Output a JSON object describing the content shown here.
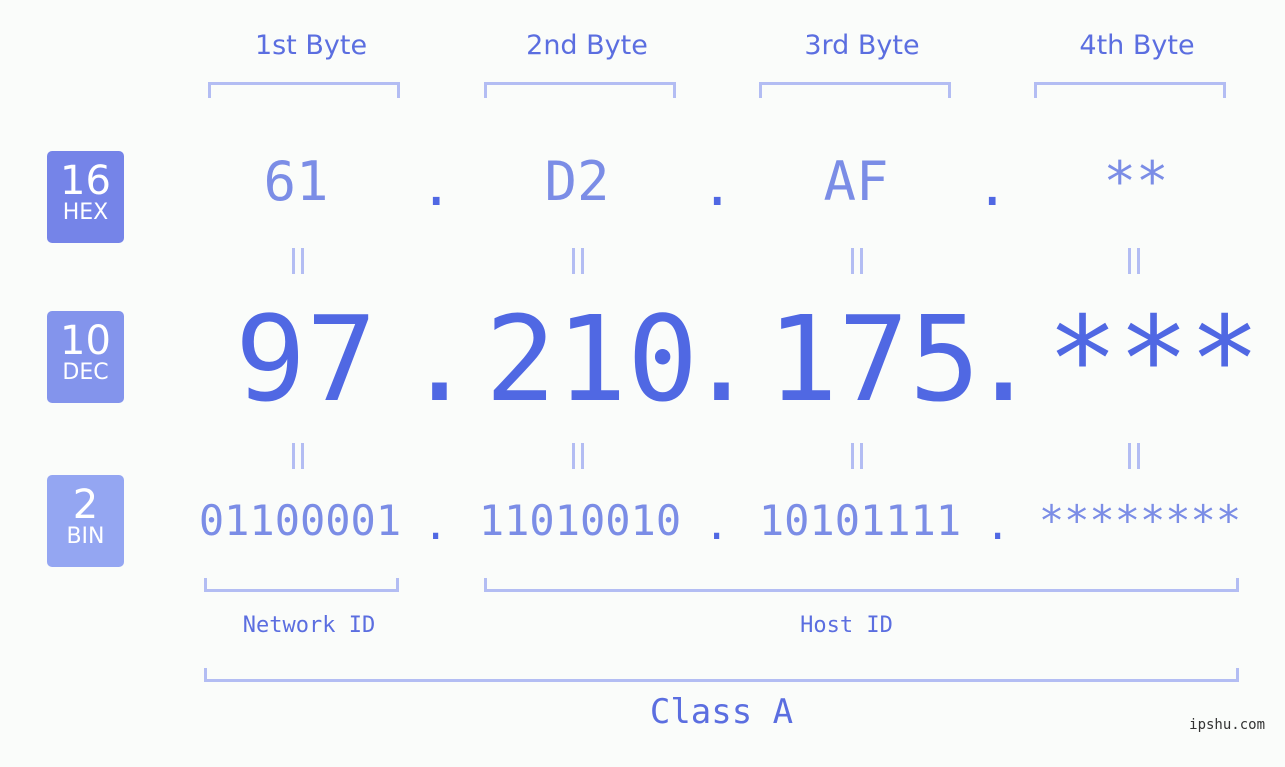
{
  "byte_headers": [
    "1st Byte",
    "2nd Byte",
    "3rd Byte",
    "4th Byte"
  ],
  "badges": {
    "hex": {
      "number": "16",
      "label": "HEX",
      "color": "#7584e8"
    },
    "dec": {
      "number": "10",
      "label": "DEC",
      "color": "#8394ec"
    },
    "bin": {
      "number": "2",
      "label": "BIN",
      "color": "#94a6f2"
    }
  },
  "hex": [
    "61",
    "D2",
    "AF",
    "**"
  ],
  "dec": [
    "97",
    "210",
    "175",
    "***"
  ],
  "bin": [
    "01100001",
    "11010010",
    "10101111",
    "********"
  ],
  "separator": ".",
  "equals": "=",
  "network_id_label": "Network ID",
  "host_id_label": "Host ID",
  "class_label": "Class A",
  "watermark": "ipshu.com",
  "colors": {
    "primary": "#5068e3",
    "secondary": "#7b8de6",
    "bracket": "#b3bdf3",
    "background": "#fafcfa"
  }
}
